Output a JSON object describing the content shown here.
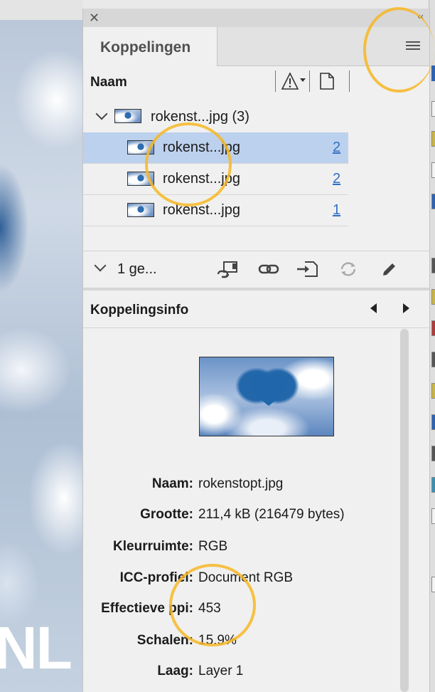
{
  "canvas": {
    "bigtext": "NL"
  },
  "panel": {
    "tab_label": "Koppelingen",
    "column_name": "Naam",
    "parent": {
      "name": "rokenst...jpg (3)"
    },
    "rows": [
      {
        "name": "rokenst...jpg",
        "page": "2",
        "selected": true
      },
      {
        "name": "rokenst...jpg",
        "page": "2",
        "selected": false
      },
      {
        "name": "rokenst...jpg",
        "page": "1",
        "selected": false
      }
    ],
    "selection_label": "1 ge...",
    "info_title": "Koppelingsinfo",
    "info": [
      {
        "label": "Naam:",
        "value": "rokenstopt.jpg"
      },
      {
        "label": "Grootte:",
        "value": "211,4 kB (216479 bytes)"
      },
      {
        "label": "Kleurruimte:",
        "value": "RGB"
      },
      {
        "label": "ICC-profiel:",
        "value": "Document RGB"
      },
      {
        "label": "Effectieve ppi:",
        "value": "453"
      },
      {
        "label": "Schalen:",
        "value": "15.9%"
      },
      {
        "label": "Laag:",
        "value": "Layer 1"
      }
    ]
  },
  "icons": {
    "close": "close-icon",
    "collapse": "double-chevron-left-icon",
    "menu": "hamburger-menu-icon",
    "warning": "warning-icon",
    "page": "page-icon",
    "relink": "relink-icon",
    "link": "link-icon",
    "goto": "go-to-link-icon",
    "update": "update-icon",
    "edit": "edit-pencil-icon",
    "prev": "previous-arrow-icon",
    "next": "next-arrow-icon"
  },
  "colors": {
    "selection": "#bcd1ee",
    "page_link": "#2f6fc6",
    "highlight_ring": "#f7b725"
  }
}
